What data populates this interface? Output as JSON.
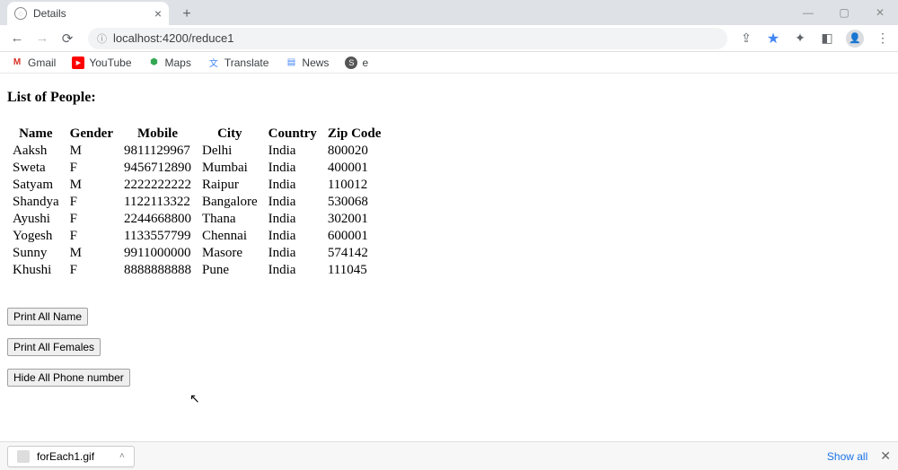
{
  "tab": {
    "title": "Details"
  },
  "address": {
    "url": "localhost:4200/reduce1"
  },
  "bookmarks": {
    "gmail": "Gmail",
    "youtube": "YouTube",
    "maps": "Maps",
    "translate": "Translate",
    "news": "News",
    "e": "e"
  },
  "page": {
    "heading": "List of People:",
    "columns": [
      "Name",
      "Gender",
      "Mobile",
      "City",
      "Country",
      "Zip Code"
    ],
    "rows": [
      {
        "name": "Aaksh",
        "gender": "M",
        "mobile": "9811129967",
        "city": "Delhi",
        "country": "India",
        "zip": "800020"
      },
      {
        "name": "Sweta",
        "gender": "F",
        "mobile": "9456712890",
        "city": "Mumbai",
        "country": "India",
        "zip": "400001"
      },
      {
        "name": "Satyam",
        "gender": "M",
        "mobile": "2222222222",
        "city": "Raipur",
        "country": "India",
        "zip": "110012"
      },
      {
        "name": "Shandya",
        "gender": "F",
        "mobile": "1122113322",
        "city": "Bangalore",
        "country": "India",
        "zip": "530068"
      },
      {
        "name": "Ayushi",
        "gender": "F",
        "mobile": "2244668800",
        "city": "Thana",
        "country": "India",
        "zip": "302001"
      },
      {
        "name": "Yogesh",
        "gender": "F",
        "mobile": "1133557799",
        "city": "Chennai",
        "country": "India",
        "zip": "600001"
      },
      {
        "name": "Sunny",
        "gender": "M",
        "mobile": "9911000000",
        "city": "Masore",
        "country": "India",
        "zip": "574142"
      },
      {
        "name": "Khushi",
        "gender": "F",
        "mobile": "8888888888",
        "city": "Pune",
        "country": "India",
        "zip": "111045"
      }
    ],
    "btn_print_name": "Print All Name",
    "btn_print_females": "Print All Females",
    "btn_hide_phone": "Hide All Phone number"
  },
  "downloads": {
    "file": "forEach1.gif",
    "show_all": "Show all"
  }
}
